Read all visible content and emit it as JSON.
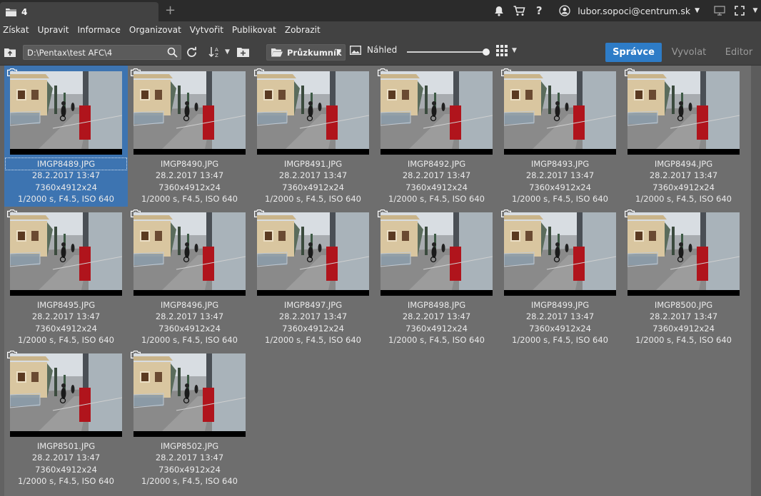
{
  "window": {
    "tab_label": "4",
    "new_tab_symbol": "+"
  },
  "titlebar": {
    "user_email": "lubor.sopoci@centrum.sk",
    "help_symbol": "?"
  },
  "menu": [
    "Získat",
    "Upravit",
    "Informace",
    "Organizovat",
    "Vytvořit",
    "Publikovat",
    "Zobrazit"
  ],
  "toolbar": {
    "path": "D:\\Pentax\\test AFC\\4",
    "view_combo": "Průzkumník",
    "preview_label": "Náhled",
    "zoom_level": 0.97
  },
  "modes": {
    "active": "Správce",
    "develop": "Vyvolat",
    "editor": "Editor"
  },
  "colors": {
    "accent": "#2e7cc7",
    "selection": "#3d74b1"
  },
  "thumbnails": [
    {
      "file": "IMGP8489.JPG",
      "date": "28.2.2017 13:47",
      "size": "7360x4912x24",
      "exif": "1/2000 s, F4.5, ISO 640",
      "selected": true
    },
    {
      "file": "IMGP8490.JPG",
      "date": "28.2.2017 13:47",
      "size": "7360x4912x24",
      "exif": "1/2000 s, F4.5, ISO 640"
    },
    {
      "file": "IMGP8491.JPG",
      "date": "28.2.2017 13:47",
      "size": "7360x4912x24",
      "exif": "1/2000 s, F4.5, ISO 640"
    },
    {
      "file": "IMGP8492.JPG",
      "date": "28.2.2017 13:47",
      "size": "7360x4912x24",
      "exif": "1/2000 s, F4.5, ISO 640"
    },
    {
      "file": "IMGP8493.JPG",
      "date": "28.2.2017 13:47",
      "size": "7360x4912x24",
      "exif": "1/2000 s, F4.5, ISO 640"
    },
    {
      "file": "IMGP8494.JPG",
      "date": "28.2.2017 13:47",
      "size": "7360x4912x24",
      "exif": "1/2000 s, F4.5, ISO 640"
    },
    {
      "file": "IMGP8495.JPG",
      "date": "28.2.2017 13:47",
      "size": "7360x4912x24",
      "exif": "1/2000 s, F4.5, ISO 640"
    },
    {
      "file": "IMGP8496.JPG",
      "date": "28.2.2017 13:47",
      "size": "7360x4912x24",
      "exif": "1/2000 s, F4.5, ISO 640"
    },
    {
      "file": "IMGP8497.JPG",
      "date": "28.2.2017 13:47",
      "size": "7360x4912x24",
      "exif": "1/2000 s, F4.5, ISO 640"
    },
    {
      "file": "IMGP8498.JPG",
      "date": "28.2.2017 13:47",
      "size": "7360x4912x24",
      "exif": "1/2000 s, F4.5, ISO 640"
    },
    {
      "file": "IMGP8499.JPG",
      "date": "28.2.2017 13:47",
      "size": "7360x4912x24",
      "exif": "1/2000 s, F4.5, ISO 640"
    },
    {
      "file": "IMGP8500.JPG",
      "date": "28.2.2017 13:47",
      "size": "7360x4912x24",
      "exif": "1/2000 s, F4.5, ISO 640"
    },
    {
      "file": "IMGP8501.JPG",
      "date": "28.2.2017 13:47",
      "size": "7360x4912x24",
      "exif": "1/2000 s, F4.5, ISO 640"
    },
    {
      "file": "IMGP8502.JPG",
      "date": "28.2.2017 13:47",
      "size": "7360x4912x24",
      "exif": "1/2000 s, F4.5, ISO 640"
    }
  ]
}
